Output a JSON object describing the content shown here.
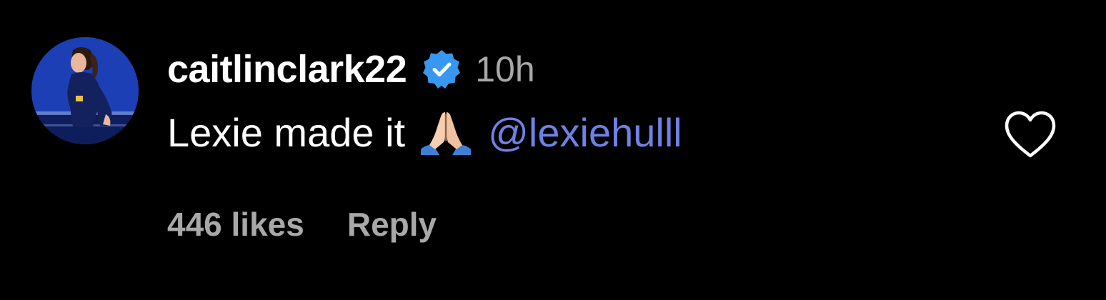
{
  "comment": {
    "username": "caitlinclark22",
    "verified": true,
    "verified_icon": "verified-badge-icon",
    "timestamp": "10h",
    "text": "Lexie made it",
    "emoji": "folded-hands-emoji",
    "mention": "@lexiehulll",
    "likes_label": "446 likes",
    "reply_label": "Reply",
    "like_icon": "heart-outline-icon"
  },
  "colors": {
    "background": "#000000",
    "username": "#ffffff",
    "secondary_text": "#a8a8a8",
    "mention": "#7081e6",
    "verified_badge": "#3897f0"
  }
}
